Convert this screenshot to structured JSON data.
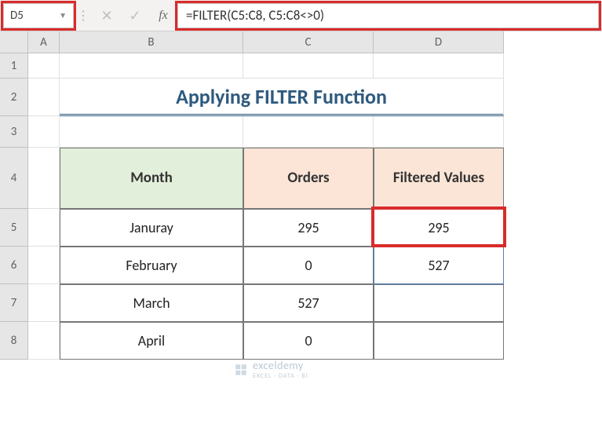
{
  "name_box": "D5",
  "formula": "=FILTER(C5:C8, C5:C8<>0)",
  "fx_label": "fx",
  "columns": [
    "A",
    "B",
    "C",
    "D"
  ],
  "rows": [
    "1",
    "2",
    "3",
    "4",
    "5",
    "6",
    "7",
    "8"
  ],
  "title": "Applying FILTER Function",
  "headers": {
    "month": "Month",
    "orders": "Orders",
    "filtered": "Filtered Values"
  },
  "table": [
    {
      "month": "Januray",
      "orders": "295",
      "filtered": "295"
    },
    {
      "month": "February",
      "orders": "0",
      "filtered": "527"
    },
    {
      "month": "March",
      "orders": "527",
      "filtered": ""
    },
    {
      "month": "April",
      "orders": "0",
      "filtered": ""
    }
  ],
  "chart_data": {
    "type": "table",
    "title": "Applying FILTER Function",
    "columns": [
      "Month",
      "Orders",
      "Filtered Values"
    ],
    "rows": [
      [
        "Januray",
        295,
        295
      ],
      [
        "February",
        0,
        527
      ],
      [
        "March",
        527,
        null
      ],
      [
        "April",
        0,
        null
      ]
    ]
  },
  "watermark": {
    "brand": "exceldemy",
    "tag": "EXCEL · DATA · BI"
  }
}
